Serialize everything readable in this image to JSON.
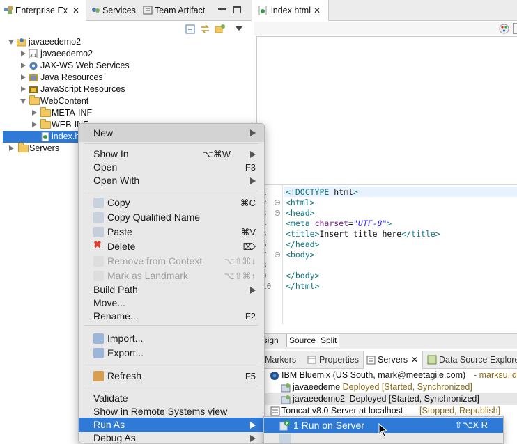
{
  "left_view": {
    "tabs": [
      {
        "label": "Enterprise Ex",
        "active": true
      },
      {
        "label": "Services"
      },
      {
        "label": "Team Artifact"
      }
    ],
    "tree": [
      {
        "label": "javaeedemo2",
        "expanded": true
      },
      {
        "label": "javaeedemo2"
      },
      {
        "label": "JAX-WS Web Services"
      },
      {
        "label": "Java Resources"
      },
      {
        "label": "JavaScript Resources"
      },
      {
        "label": "WebContent",
        "expanded": true
      },
      {
        "label": "META-INF"
      },
      {
        "label": "WEB-INF"
      },
      {
        "label": "index.h",
        "selected": true
      },
      {
        "label": "Servers"
      }
    ]
  },
  "editor": {
    "tab_label": "index.html",
    "code_lines": [
      {
        "n": "1",
        "text": "<!DOCTYPE html>"
      },
      {
        "n": "2",
        "text": "<html>"
      },
      {
        "n": "3",
        "text": "<head>"
      },
      {
        "n": "4",
        "text": "<meta charset=\"UTF-8\">"
      },
      {
        "n": "5",
        "text": "<title>Insert title here</title>"
      },
      {
        "n": "6",
        "text": "</head>"
      },
      {
        "n": "7",
        "text": "<body>"
      },
      {
        "n": "8",
        "text": ""
      },
      {
        "n": "9",
        "text": "</body>"
      },
      {
        "n": "10",
        "text": "</html>"
      }
    ],
    "page_tabs": [
      "esign",
      "Source",
      "Split"
    ]
  },
  "servers_view": {
    "tabs": [
      "Markers",
      "Properties",
      "Servers",
      "Data Source Explorer"
    ],
    "rows": [
      {
        "name": "IBM Bluemix (US South, mark@meetagile.com)",
        "detail": " - marksu.idv.tw -"
      },
      {
        "name": "javaeedemo",
        "detail": " - Deployed  [Started, Synchronized]"
      },
      {
        "name": "javaeedemo2",
        "detail": " - Deployed  [Started, Synchronized]"
      },
      {
        "name": "Tomcat v8.0 Server at localhost",
        "detail": "  [Stopped, Republish]"
      }
    ]
  },
  "context_menu": {
    "items": [
      {
        "label": "New",
        "submenu": true
      },
      {
        "label": "Show In",
        "shortcut": "⌥⌘W",
        "submenu": true
      },
      {
        "label": "Open",
        "shortcut": "F3"
      },
      {
        "label": "Open With",
        "submenu": true
      },
      {
        "label": "Copy",
        "shortcut": "⌘C"
      },
      {
        "label": "Copy Qualified Name"
      },
      {
        "label": "Paste",
        "shortcut": "⌘V"
      },
      {
        "label": "Delete",
        "shortcut": "⌦"
      },
      {
        "label": "Remove from Context",
        "shortcut": "⌥⇧⌘↓",
        "disabled": true
      },
      {
        "label": "Mark as Landmark",
        "shortcut": "⌥⇧⌘↑",
        "disabled": true
      },
      {
        "label": "Build Path",
        "submenu": true
      },
      {
        "label": "Move..."
      },
      {
        "label": "Rename...",
        "shortcut": "F2"
      },
      {
        "label": "Import..."
      },
      {
        "label": "Export..."
      },
      {
        "label": "Refresh",
        "shortcut": "F5"
      },
      {
        "label": "Validate"
      },
      {
        "label": "Show in Remote Systems view"
      },
      {
        "label": "Run As",
        "submenu": true,
        "highlighted": true
      },
      {
        "label": "Debug As",
        "submenu": true
      }
    ]
  },
  "run_as_submenu": {
    "items": [
      {
        "label": "1 Run on Server",
        "shortcut": "⇧⌥X R",
        "highlighted": true
      }
    ]
  },
  "colors": {
    "highlight": "#2f7ad6",
    "selection": "#2f7ad6"
  }
}
